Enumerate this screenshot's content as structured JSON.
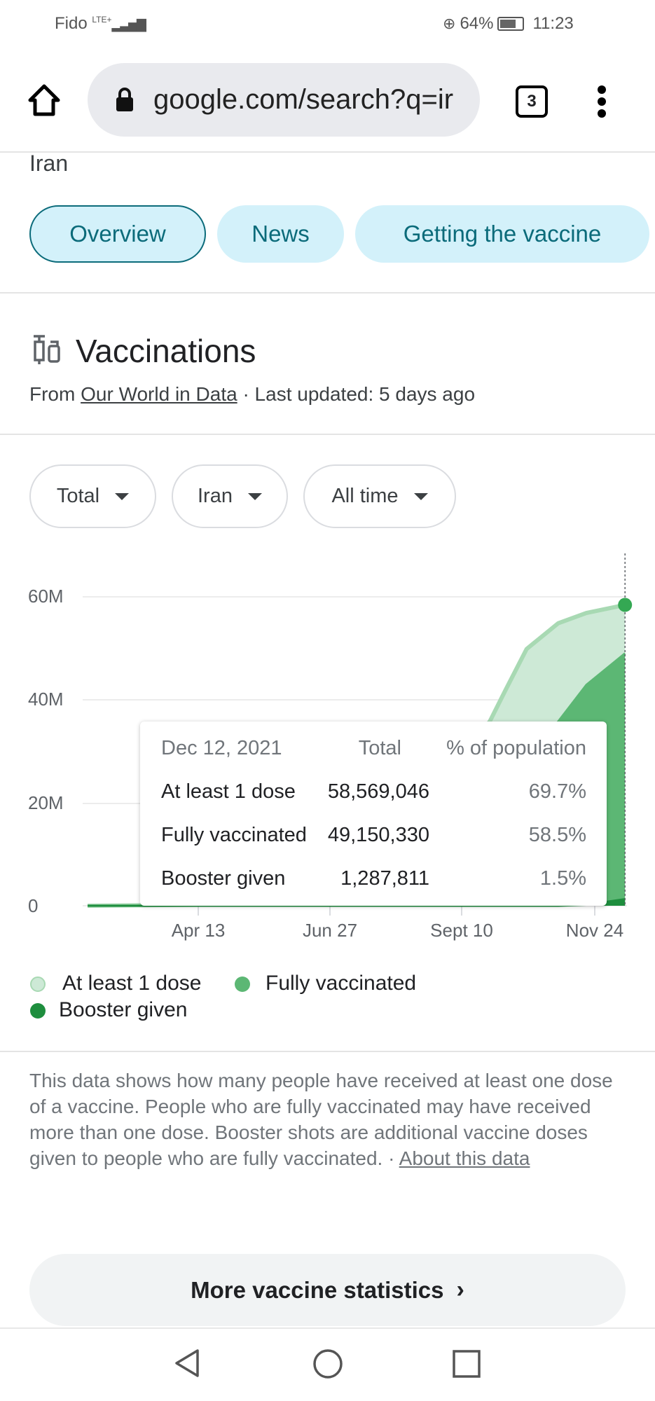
{
  "status_bar": {
    "carrier": "Fido",
    "network": "LTE+",
    "battery": "64%",
    "time": "11:23"
  },
  "browser": {
    "url": "google.com/search?q=ir",
    "tab_count": "3"
  },
  "header": {
    "query_title": "Iran",
    "tabs": [
      {
        "label": "Overview",
        "selected": true
      },
      {
        "label": "News"
      },
      {
        "label": "Getting the vaccine"
      }
    ]
  },
  "section": {
    "title": "Vaccinations",
    "source_prefix": "From ",
    "source_link": "Our World in Data",
    "updated": " · Last updated: 5 days ago"
  },
  "filters": [
    {
      "label": "Total"
    },
    {
      "label": "Iran"
    },
    {
      "label": "All time"
    }
  ],
  "tooltip": {
    "date": "Dec 12, 2021",
    "col_total": "Total",
    "col_pct": "% of population",
    "rows": [
      {
        "label": "At least 1 dose",
        "total": "58,569,046",
        "pct": "69.7%"
      },
      {
        "label": "Fully vaccinated",
        "total": "49,150,330",
        "pct": "58.5%"
      },
      {
        "label": "Booster given",
        "total": "1,287,811",
        "pct": "1.5%"
      }
    ]
  },
  "chart_data": {
    "type": "area",
    "x_ticks": [
      "Apr 13",
      "Jun 27",
      "Sept 10",
      "Nov 24"
    ],
    "y_ticks": [
      "0",
      "20M",
      "40M",
      "60M"
    ],
    "ylim": [
      0,
      68600000
    ],
    "grid": true,
    "legend": "bottom",
    "x": [
      "2021-02-09",
      "2021-04-13",
      "2021-05-15",
      "2021-06-15",
      "2021-07-15",
      "2021-08-05",
      "2021-08-25",
      "2021-09-10",
      "2021-09-26",
      "2021-10-05",
      "2021-10-17",
      "2021-11-04",
      "2021-11-20",
      "2021-12-12"
    ],
    "series": [
      {
        "name": "At least 1 dose",
        "color": "#a8d9b3",
        "fill": "#cde9d6",
        "values": [
          0,
          200000,
          1000000,
          3000000,
          8000000,
          14000000,
          22000000,
          29000000,
          35900000,
          42000000,
          50000000,
          55000000,
          57000000,
          58569046
        ]
      },
      {
        "name": "Fully vaccinated",
        "color": "#5cb774",
        "fill": "#5cb774",
        "values": [
          0,
          50000,
          300000,
          1000000,
          2500000,
          4000000,
          7000000,
          11000000,
          16000000,
          21000000,
          28000000,
          35900000,
          43000000,
          49150330
        ]
      },
      {
        "name": "Booster given",
        "color": "#1e8e3e",
        "fill": "#1e8e3e",
        "values": [
          0,
          0,
          0,
          0,
          0,
          0,
          0,
          0,
          0,
          0,
          0,
          0,
          200000,
          1287811
        ]
      }
    ]
  },
  "description": {
    "text": "This data shows how many people have received at least one dose of a vaccine. People who are fully vaccinated may have received more than one dose. Booster shots are additional vaccine doses given to people who are fully vaccinated.  · ",
    "link": "About this data"
  },
  "more_button": {
    "label": "More vaccine statistics"
  }
}
